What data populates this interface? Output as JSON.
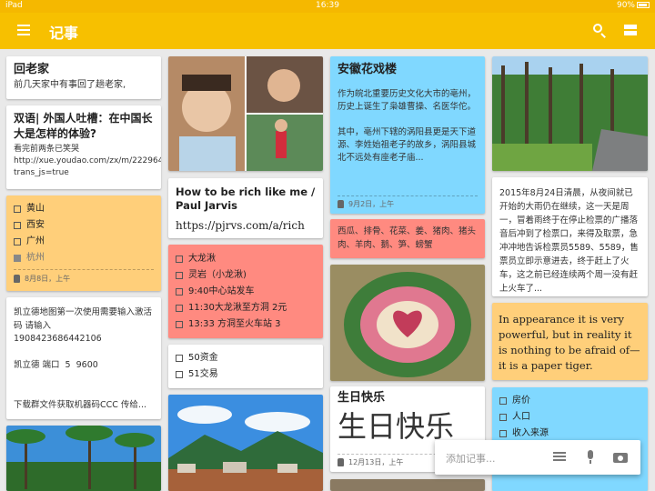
{
  "status": {
    "left": "iPad",
    "time": "16:39",
    "battery": "90%"
  },
  "toolbar": {
    "title": "记事"
  },
  "notes": {
    "hometown": {
      "title": "回老家",
      "body": "前几天家中有事回了趟老家,"
    },
    "bilingual": {
      "title": "双语| 外国人吐槽：在中国长大是怎样的体验?",
      "body": "看完前两条已笑哭\nhttp://xue.youdao.com/zx/m/222964?trans_js=true"
    },
    "cities": {
      "items": [
        {
          "label": "黄山",
          "checked": false
        },
        {
          "label": "西安",
          "checked": false
        },
        {
          "label": "广州",
          "checked": false
        },
        {
          "label": "杭州",
          "checked": true
        }
      ],
      "reminder": "8月8日，上午"
    },
    "map": {
      "body": "凯立德地图第一次使用需要输入激活码 请输入\n1908423686442106\n\n凯立德 端口  5  9600\n\n\n下载群文件获取机器码CCC 传给..."
    },
    "rich": {
      "title": "How to be rich like me / Paul Jarvis",
      "link": "https://pjrvs.com/a/rich"
    },
    "trip": {
      "items": [
        "大龙湫",
        "灵岩（小龙湫)",
        "9:40中心站发车",
        "11:30大龙湫至方洞 2元",
        "13:33 方洞至火车站 3"
      ]
    },
    "money": {
      "items": [
        "50资金",
        "51交易"
      ]
    },
    "opera": {
      "title": "安徽花戏楼",
      "body": "作为皖北重要历史文化大市的亳州，历史上诞生了枭雄曹操、名医华佗。\n\n其中，亳州下辖的涡阳县更是天下道源、李姓始祖老子的故乡，涡阳县城北不远处有座老子庙...",
      "reminder": "9月2日，上午"
    },
    "food": {
      "body": "西瓜、排骨、花菜、姜、猪肉、猪头肉、羊肉、鹅、笋、螃蟹"
    },
    "birthday": {
      "title": "生日快乐",
      "big": "生日快乐",
      "reminder": "12月13日，上午"
    },
    "train": {
      "body": "2015年8月24日清晨，从夜间就已开始的大雨仍在继续，这一天是周一，冒着雨终于在停止检票的广播落音后冲到了检票口，来得及取票，急冲冲地告诉检票员5589、5589，售票员立即示意进去，终于赶上了火车，这之前已经连续两个周一没有赶上火车了..."
    },
    "tiger": {
      "body": "In appearance it is very powerful, but in reality it is nothing to be afraid of—it is a paper tiger."
    },
    "house": {
      "items": [
        "房价",
        "人口",
        "收入来源"
      ]
    }
  },
  "add_bar": {
    "placeholder": "添加记事..."
  },
  "colors": {
    "toolbar": "#f7c000",
    "orange_note": "#ffcf7a",
    "blue_note": "#80d8ff",
    "red_note": "#ff8a80"
  }
}
